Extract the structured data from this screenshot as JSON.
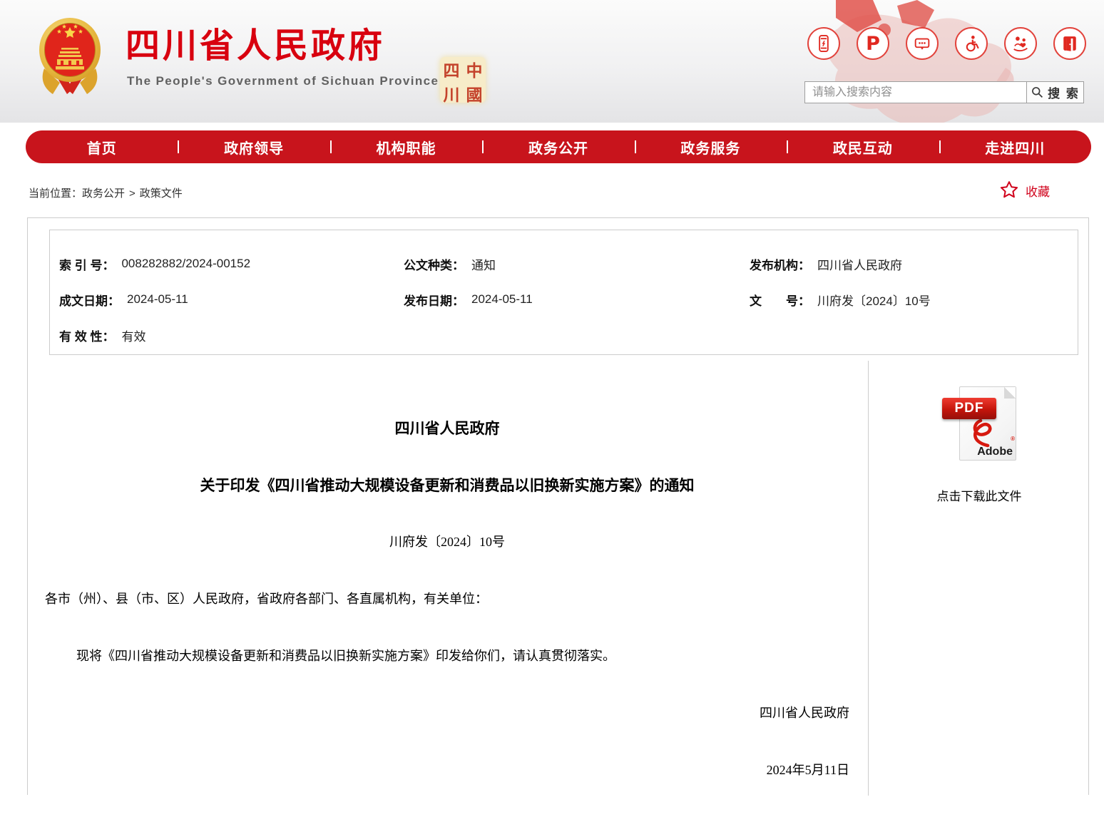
{
  "colors": {
    "nav_red": "#c8141c",
    "brand_red": "#d8000f",
    "accent_red": "#e02820",
    "star_red": "#d0021b"
  },
  "header": {
    "site_title": "四川省人民政府",
    "site_subtitle": "The People's Government of Sichuan Province",
    "seal": {
      "chars": [
        "四",
        "中",
        "川",
        "國"
      ]
    },
    "quick_icons": [
      {
        "name": "mobile-app-icon"
      },
      {
        "name": "media-platform-icon",
        "glyph": "P"
      },
      {
        "name": "message-board-icon"
      },
      {
        "name": "accessibility-icon"
      },
      {
        "name": "care-version-icon"
      },
      {
        "name": "login-door-icon"
      }
    ],
    "search": {
      "placeholder": "请输入搜索内容",
      "button_label": "搜 索"
    }
  },
  "nav": {
    "items": [
      {
        "label": "首页"
      },
      {
        "label": "政府领导"
      },
      {
        "label": "机构职能"
      },
      {
        "label": "政务公开"
      },
      {
        "label": "政务服务"
      },
      {
        "label": "政民互动"
      },
      {
        "label": "走进四川"
      }
    ]
  },
  "breadcrumb": {
    "prefix": "当前位置：",
    "level1": "政务公开",
    "separator": ">",
    "level2": "政策文件"
  },
  "favorite": {
    "label": "收藏"
  },
  "meta": {
    "rows": [
      {
        "cells": [
          {
            "label": "索 引 号：",
            "value": "008282882/2024-00152"
          },
          {
            "label": "公文种类：",
            "value": "通知"
          },
          {
            "label": "发布机构：",
            "value": "四川省人民政府"
          }
        ]
      },
      {
        "cells": [
          {
            "label": "成文日期：",
            "value": "2024-05-11"
          },
          {
            "label": "发布日期：",
            "value": "2024-05-11"
          },
          {
            "label": "文　　号：",
            "value": "川府发〔2024〕10号"
          }
        ]
      },
      {
        "cells": [
          {
            "label": "有 效 性：",
            "value": "有效"
          }
        ]
      }
    ]
  },
  "document": {
    "org_line": "四川省人民政府",
    "title_line": "关于印发《四川省推动大规模设备更新和消费品以旧换新实施方案》的通知",
    "doc_number": "川府发〔2024〕10号",
    "salutation": "各市（州）、县（市、区）人民政府，省政府各部门、各直属机构，有关单位：",
    "paragraph": "现将《四川省推动大规模设备更新和消费品以旧换新实施方案》印发给你们，请认真贯彻落实。",
    "signature": "四川省人民政府",
    "date": "2024年5月11日"
  },
  "attachment": {
    "pdf_label": "PDF",
    "brand": "Adobe",
    "download_text": "点击下载此文件"
  }
}
